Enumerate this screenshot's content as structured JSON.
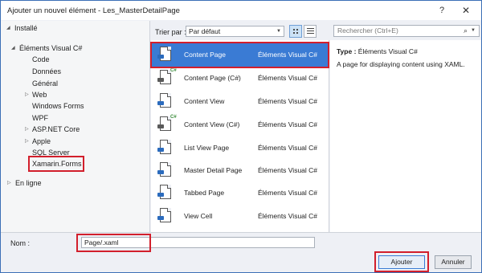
{
  "window": {
    "title": "Ajouter un nouvel élément - Les_MasterDetailPage",
    "help_label": "?",
    "close_label": "✕"
  },
  "tree": {
    "installed": "Installé",
    "visual_cs": "Éléments Visual C#",
    "items": [
      "Code",
      "Données",
      "Général",
      "Web",
      "Windows Forms",
      "WPF",
      "ASP.NET Core",
      "Apple",
      "SQL Server",
      "Xamarin.Forms"
    ],
    "online": "En ligne"
  },
  "toolbar": {
    "sort_label": "Trier par :",
    "sort_value": "Par défaut",
    "search_placeholder": "Rechercher (Ctrl+E)"
  },
  "templates": [
    {
      "name": "Content Page",
      "category": "Éléments Visual C#",
      "selected": true,
      "icon": "xaml-page-icon"
    },
    {
      "name": "Content Page (C#)",
      "category": "Éléments Visual C#",
      "selected": false,
      "icon": "cs-page-icon"
    },
    {
      "name": "Content View",
      "category": "Éléments Visual C#",
      "selected": false,
      "icon": "xaml-page-icon"
    },
    {
      "name": "Content View (C#)",
      "category": "Éléments Visual C#",
      "selected": false,
      "icon": "cs-page-icon"
    },
    {
      "name": "List View Page",
      "category": "Éléments Visual C#",
      "selected": false,
      "icon": "xaml-page-icon"
    },
    {
      "name": "Master Detail Page",
      "category": "Éléments Visual C#",
      "selected": false,
      "icon": "xaml-page-icon"
    },
    {
      "name": "Tabbed Page",
      "category": "Éléments Visual C#",
      "selected": false,
      "icon": "xaml-page-icon"
    },
    {
      "name": "View Cell",
      "category": "Éléments Visual C#",
      "selected": false,
      "icon": "xaml-page-icon"
    }
  ],
  "detail": {
    "type_label": "Type :",
    "type_value": "Éléments Visual C#",
    "description": "A page for displaying content using XAML."
  },
  "footer": {
    "name_label": "Nom :",
    "name_value": "Page/.xaml",
    "add_label": "Ajouter",
    "cancel_label": "Annuler"
  },
  "colors": {
    "selection": "#3a7bd4",
    "annotation": "#d21f2c"
  }
}
